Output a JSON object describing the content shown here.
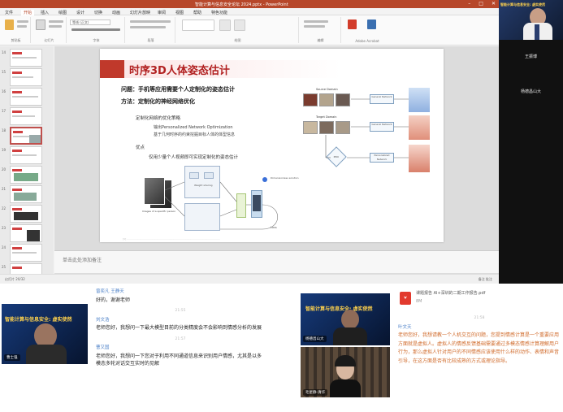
{
  "ppt": {
    "window_title": "智能计算与信息安全论坛 2024.pptx - PowerPoint",
    "tabs": [
      "文件",
      "开始",
      "插入",
      "绘图",
      "设计",
      "切换",
      "动画",
      "幻灯片放映",
      "审阅",
      "视图",
      "帮助",
      "特色功能"
    ],
    "font_box": "等线 (正文)",
    "ribbon_groups": [
      "剪贴板",
      "幻灯片",
      "字体",
      "段落",
      "绘图",
      "编辑",
      "Adobe Acrobat"
    ],
    "thumb_numbers": [
      "14",
      "15",
      "16",
      "17",
      "18",
      "19",
      "20",
      "21",
      "22",
      "23",
      "24",
      "25"
    ],
    "notes_placeholder": "单击此处添加备注",
    "status_left": "幻灯片 20/32",
    "status_right": "备注  批注"
  },
  "slide": {
    "title": "时序3D人体姿态估计",
    "bullet_problem": "问题：手机等应用需要个人定制化的姿态估计",
    "bullet_method": "方法：定制化的神经网络优化",
    "sub1": "定制化网络的优化策略",
    "sub1a": "输出Personalized Network Optimization",
    "sub1b": "基于几何时序的约束挖掘目标人体的体型信息",
    "sub2": "优点",
    "sub2a": "仅用少量个人视频即可实现定制化的姿态估计",
    "diag_labels": {
      "source_domain": "Source Domain",
      "target_domain": "Target Domain",
      "general_network": "General Network",
      "personalized_network": "Personalized Network",
      "pno": "PNO",
      "dual_eval": "Dimensionless solution",
      "images": "Images of a specific person",
      "weight": "Weight sharing",
      "loss": "Loss"
    }
  },
  "speaker": {
    "banner": "智能计算与信息安全: 虚实使然",
    "names": [
      "王振博",
      "杨德昌山大"
    ]
  },
  "chat_left": {
    "messages": [
      {
        "name": "曾奕凡 王静天",
        "text": "好的，谢谢老师"
      },
      {
        "name": "刘文浩",
        "text": "老师您好，我想问一下最大模型目前的分类精度会不会影响到情感分析的发展"
      },
      {
        "name": "曹又国",
        "text": "老师您好，我想问一下您对于利用不同通道信息来识别用户情感，尤其是以多模态多轮对话交互实时的见解"
      }
    ],
    "time_labels": [
      "21:55",
      "21:57"
    ]
  },
  "chat_right": {
    "file_name": "课题报告 AI+深圳的二期工作报告.pdf",
    "file_size": "8M",
    "messages": [
      {
        "name": "叶文天",
        "text": "老师您好，我想请教一个人机交互的问题，您提到情感计算是一个重要应用方面就是虚拟人。虚拟人的情感反馈基础需要通过多模态情感计算理解用户行为，那么虚拟人针对用户的不同情感应该使用什么样的动作、表情和声音引导，在这方面是否有比较成熟的方式或理论指导。"
      }
    ],
    "time_labels": [
      "21:58"
    ]
  },
  "video_left": {
    "banner": "智能计算与信息安全: 虚实使然",
    "name_tag": "曹士强"
  },
  "video_right": {
    "banner": "智能计算与信息安全: 虚实使然",
    "tag_top": "杨德昌山大",
    "tag_bottom": "毛星静-清华"
  },
  "colors": {
    "ppt_accent": "#b7472a",
    "slide_red": "#b22222",
    "chat_name": "#4a7fc7",
    "video_bg": "#0c1f46",
    "banner_text": "#ffd24d"
  }
}
